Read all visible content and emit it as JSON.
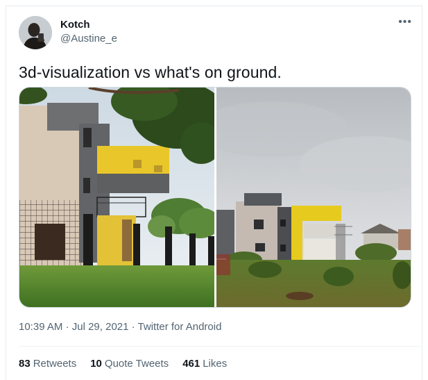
{
  "user": {
    "display_name": "Kotch",
    "handle": "@Austine_e"
  },
  "tweet": {
    "text": "3d-visualization vs what's on ground.",
    "time": "10:39 AM",
    "date": "Jul 29, 2021",
    "source": "Twitter for Android",
    "separator": "·"
  },
  "stats": {
    "retweets_count": "83",
    "retweets_label": "Retweets",
    "quotes_count": "10",
    "quotes_label": "Quote Tweets",
    "likes_count": "461",
    "likes_label": "Likes"
  },
  "icons": {
    "more": "more-horizontal-icon"
  },
  "colors": {
    "text_primary": "#0f1419",
    "text_secondary": "#536471",
    "border": "#cfd9de",
    "building_yellow": "#e8c51c"
  }
}
